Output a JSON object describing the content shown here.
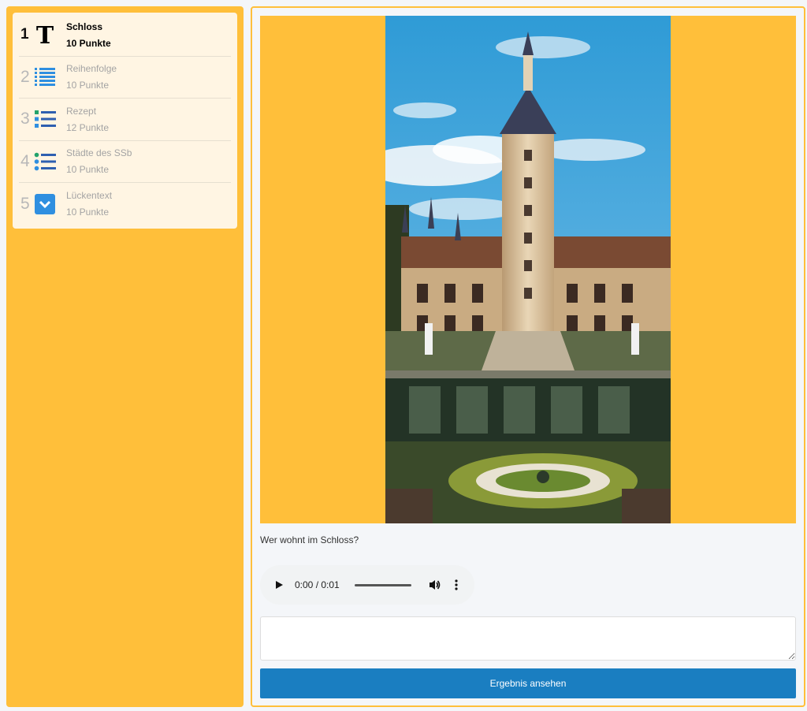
{
  "sidebar": {
    "tasks": [
      {
        "num": "1",
        "title": "Schloss",
        "points": "10 Punkte",
        "icon": "text-T-icon",
        "active": true
      },
      {
        "num": "2",
        "title": "Reihenfolge",
        "points": "10 Punkte",
        "icon": "ordered-list-icon"
      },
      {
        "num": "3",
        "title": "Rezept",
        "points": "12 Punkte",
        "icon": "checklist-icon"
      },
      {
        "num": "4",
        "title": "Städte des SSb",
        "points": "10 Punkte",
        "icon": "bullet-list-icon"
      },
      {
        "num": "5",
        "title": "Lückentext",
        "points": "10 Punkte",
        "icon": "dropdown-icon"
      }
    ]
  },
  "main": {
    "question": "Wer wohnt im Schloss?",
    "audio": {
      "time": "0:00 / 0:01"
    },
    "answer_value": "",
    "submit_label": "Ergebnis ansehen"
  },
  "colors": {
    "accent": "#ffbf3a",
    "button": "#1a7ec1",
    "panel": "#fff5e3"
  }
}
